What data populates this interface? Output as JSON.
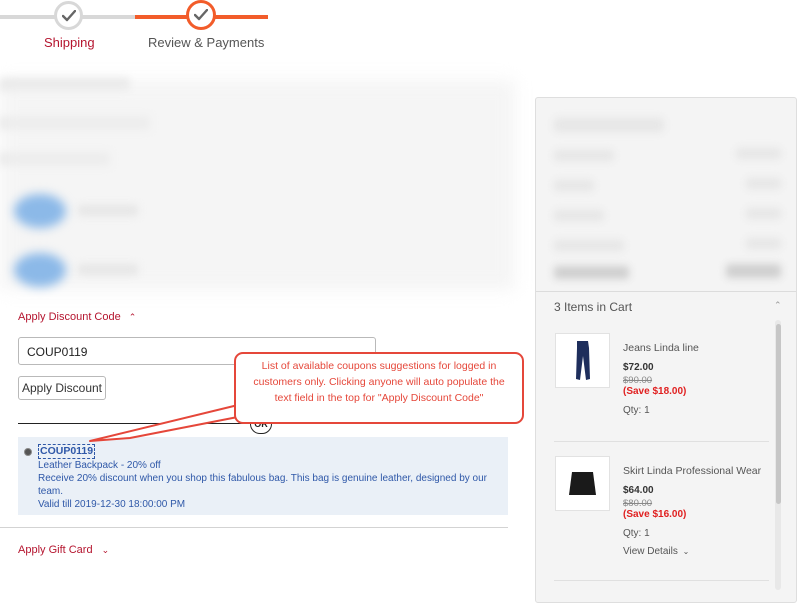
{
  "progress": {
    "steps": [
      {
        "label": "Shipping",
        "state": "done"
      },
      {
        "label": "Review & Payments",
        "state": "current"
      }
    ],
    "colors": {
      "active": "#f25c2a",
      "inactive": "#d8d8d8",
      "label_done": "#b5152f"
    }
  },
  "discount": {
    "toggle_label": "Apply Discount Code",
    "input_value": "COUP0119",
    "apply_button": "Apply Discount",
    "or_label": "OR",
    "coupon": {
      "code": "COUP0119",
      "title": "Leather Backpack - 20% off",
      "description": "Receive 20% discount when you shop this fabulous bag. This bag is genuine leather, designed by our team.",
      "validity": "Valid till 2019-12-30 18:00:00 PM"
    }
  },
  "callout": {
    "text": "List of available coupons suggestions for logged in customers only. Clicking anyone will auto populate the text field in the top for \"Apply Discount Code\""
  },
  "gift_card": {
    "toggle_label": "Apply Gift Card"
  },
  "cart": {
    "header": "3 Items in Cart",
    "items": [
      {
        "name": "Jeans Linda line",
        "price": "$72.00",
        "old_price": "$90.00",
        "save": "(Save $18.00)",
        "qty": "Qty: 1",
        "image": "jeans-image"
      },
      {
        "name": "Skirt Linda Professional Wear",
        "price": "$64.00",
        "old_price": "$80.00",
        "save": "(Save $16.00)",
        "qty": "Qty: 1",
        "details_label": "View Details",
        "image": "skirt-image"
      }
    ]
  }
}
